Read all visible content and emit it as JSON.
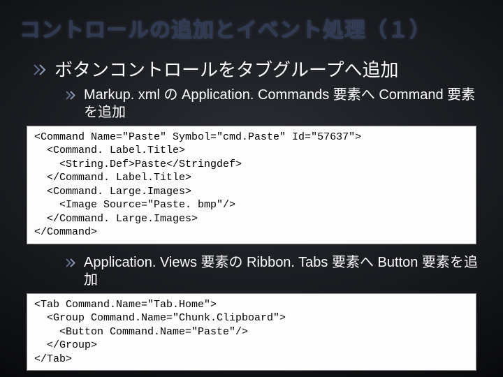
{
  "slide": {
    "title": "コントロールの追加とイベント処理（１）",
    "bullet1": "ボタンコントロールをタブグループへ追加",
    "bullet1_sub": "Markup. xml の Application. Commands 要素へ Command 要素を追加",
    "code1": "<Command Name=\"Paste\" Symbol=\"cmd.Paste\" Id=\"57637\">\n  <Command. Label.Title>\n    <String.Def>Paste</Stringdef>\n  </Command. Label.Title>\n  <Command. Large.Images>\n    <Image Source=\"Paste. bmp\"/>\n  </Command. Large.Images>\n</Command>",
    "bullet2": "Application. Views 要素の Ribbon. Tabs 要素へ Button 要素を追加",
    "code2": "<Tab Command.Name=\"Tab.Home\">\n  <Group Command.Name=\"Chunk.Clipboard\">\n    <Button Command.Name=\"Paste\"/>\n  </Group>\n</Tab>"
  }
}
